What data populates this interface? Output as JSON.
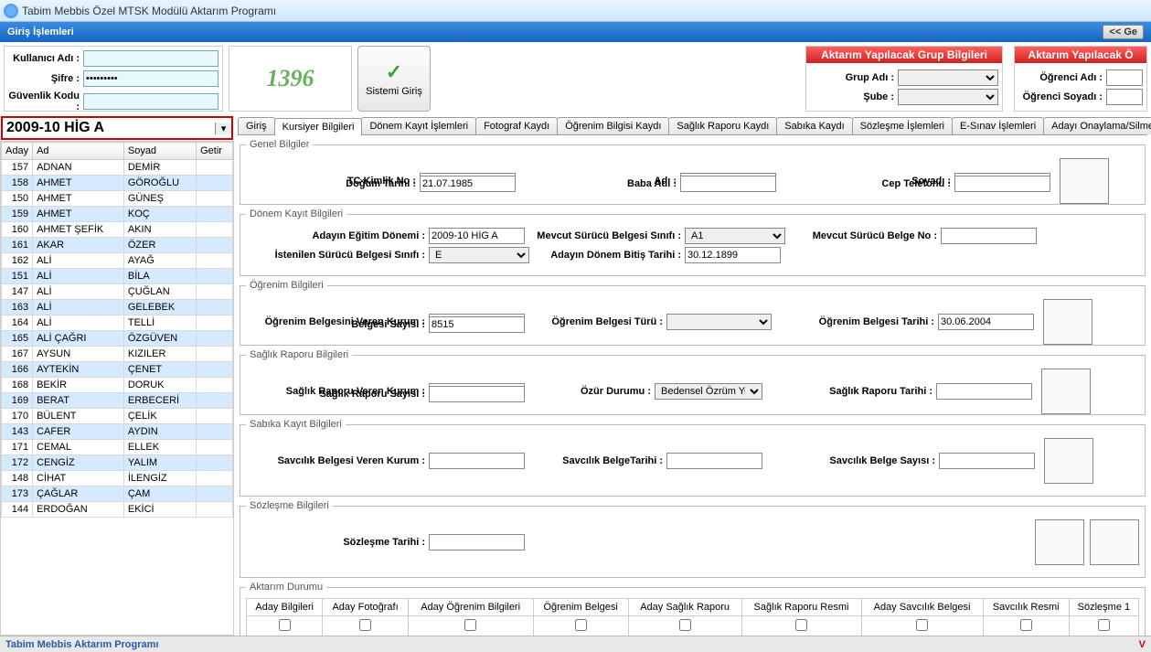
{
  "window": {
    "title": "Tabim Mebbis Özel MTSK Modülü Aktarım Programı"
  },
  "section": {
    "title": "Giriş İşlemleri",
    "back": "<< Ge"
  },
  "login": {
    "user_lbl": "Kullanıcı Adı :",
    "user_val": "",
    "pass_lbl": "Şifre :",
    "pass_val": "•••••••••",
    "code_lbl": "Güvenlik Kodu :",
    "code_val": "",
    "captcha": "1396",
    "btn": "Sistemi Giriş"
  },
  "group_box": {
    "title": "Aktarım Yapılacak Grup Bilgileri",
    "grup_lbl": "Grup Adı :",
    "sube_lbl": "Şube :"
  },
  "student_box": {
    "title": "Aktarım Yapılacak Ö",
    "ad_lbl": "Öğrenci Adı :",
    "soyad_lbl": "Öğrenci Soyadı :"
  },
  "period": "2009-10 HİG A",
  "grid": {
    "cols": [
      "Aday",
      "Ad",
      "Soyad",
      "Getir"
    ],
    "rows": [
      [
        "157",
        "ADNAN",
        "DEMİR",
        ""
      ],
      [
        "158",
        "AHMET",
        "GÖROĞLU",
        ""
      ],
      [
        "150",
        "AHMET",
        "GÜNEŞ",
        ""
      ],
      [
        "159",
        "AHMET",
        "KOÇ",
        ""
      ],
      [
        "160",
        "AHMET ŞEFİK",
        "AKIN",
        ""
      ],
      [
        "161",
        "AKAR",
        "ÖZER",
        ""
      ],
      [
        "162",
        "ALİ",
        "AYAĞ",
        ""
      ],
      [
        "151",
        "ALİ",
        "BİLA",
        ""
      ],
      [
        "147",
        "ALİ",
        "ÇUĞLAN",
        ""
      ],
      [
        "163",
        "ALİ",
        "GELEBEK",
        ""
      ],
      [
        "164",
        "ALİ",
        "TELLİ",
        ""
      ],
      [
        "165",
        "ALİ ÇAĞRI",
        "ÖZGÜVEN",
        ""
      ],
      [
        "167",
        "AYSUN",
        "KIZILER",
        ""
      ],
      [
        "166",
        "AYTEKİN",
        "ÇENET",
        ""
      ],
      [
        "168",
        "BEKİR",
        "DORUK",
        ""
      ],
      [
        "169",
        "BERAT",
        "ERBECERİ",
        ""
      ],
      [
        "170",
        "BÜLENT",
        "ÇELİK",
        ""
      ],
      [
        "143",
        "CAFER",
        "AYDIN",
        ""
      ],
      [
        "171",
        "CEMAL",
        "ELLEK",
        ""
      ],
      [
        "172",
        "CENGİZ",
        "YALIM",
        ""
      ],
      [
        "148",
        "CİHAT",
        "İLENGİZ",
        ""
      ],
      [
        "173",
        "ÇAĞLAR",
        "ÇAM",
        ""
      ],
      [
        "144",
        "ERDOĞAN",
        "EKİCİ",
        ""
      ]
    ]
  },
  "tabs": [
    "Giriş",
    "Kursiyer Bilgileri",
    "Dönem Kayıt İşlemleri",
    "Fotograf Kaydı",
    "Öğrenim Bilgisi Kaydı",
    "Sağlık Raporu Kaydı",
    "Sabıka Kaydı",
    "Sözleşme İşlemleri",
    "E-Sınav İşlemleri",
    "Adayı Onaylama/Silme"
  ],
  "active_tab": 1,
  "genel": {
    "legend": "Genel Bilgiler",
    "tc_lbl": "TC Kimlik No :",
    "tc_val": "",
    "dogum_lbl": "Doğum Tarihi :",
    "dogum_val": "21.07.1985",
    "adi_lbl": "Adı :",
    "adi_val": "",
    "baba_lbl": "Baba Adı :",
    "baba_val": "",
    "soyadi_lbl": "Soyadı :",
    "soyadi_val": "",
    "cep_lbl": "Cep Telefonu :",
    "cep_val": ""
  },
  "donem": {
    "legend": "Dönem Kayıt Bilgileri",
    "egitim_lbl": "Adayın Eğitim Dönemi :",
    "egitim_val": "2009-10 HİG A",
    "istenilen_lbl": "İstenilen Sürücü Belgesi Sınıfı :",
    "istenilen_val": "E",
    "mevcut_sinif_lbl": "Mevcut Sürücü Belgesi Sınıfı :",
    "mevcut_sinif_val": "A1",
    "bitis_lbl": "Adayın Dönem Bitiş Tarihi :",
    "bitis_val": "30.12.1899",
    "belge_no_lbl": "Mevcut Sürücü Belge No :",
    "belge_no_val": ""
  },
  "ogrenim": {
    "legend": "Öğrenim Bilgileri",
    "kurum_lbl": "Öğrenim Belgesini Veren Kurum :",
    "kurum_val": "",
    "sayi_lbl": "Belgesi Sayısı :",
    "sayi_val": "8515",
    "turu_lbl": "Öğrenim Belgesi Türü :",
    "turu_val": "",
    "tarih_lbl": "Öğrenim Belgesi Tarihi :",
    "tarih_val": "30.06.2004"
  },
  "saglik": {
    "legend": "Sağlık Raporu Bilgileri",
    "kurum_lbl": "Sağlık Raporu Veren Kurum :",
    "kurum_val": "",
    "sayi_lbl": "Sağlık Raporu Sayısı :",
    "sayi_val": "",
    "ozur_lbl": "Özür Durumu :",
    "ozur_val": "Bedensel Özrüm Yok",
    "tarih_lbl": "Sağlık Raporu Tarihi :",
    "tarih_val": ""
  },
  "sabika": {
    "legend": "Sabıka Kayıt Bilgileri",
    "kurum_lbl": "Savcılık Belgesi Veren Kurum :",
    "kurum_val": "",
    "tarih_lbl": "Savcılık BelgeTarihi :",
    "tarih_val": "",
    "sayi_lbl": "Savcılık Belge Sayısı :",
    "sayi_val": ""
  },
  "sozlesme": {
    "legend": "Sözleşme Bilgileri",
    "tarih_lbl": "Sözleşme Tarihi :",
    "tarih_val": ""
  },
  "aktarim": {
    "legend": "Aktarım Durumu",
    "cols": [
      "Aday Bilgileri",
      "Aday Fotoğrafı",
      "Aday Öğrenim Bilgileri",
      "Öğrenim Belgesi",
      "Aday Sağlık Raporu",
      "Sağlık Raporu Resmi",
      "Aday Savcılık Belgesi",
      "Savcılık Resmi",
      "Sözleşme 1"
    ]
  },
  "footer": {
    "left": "Tabim Mebbis Aktarım Programı",
    "right": "V"
  }
}
